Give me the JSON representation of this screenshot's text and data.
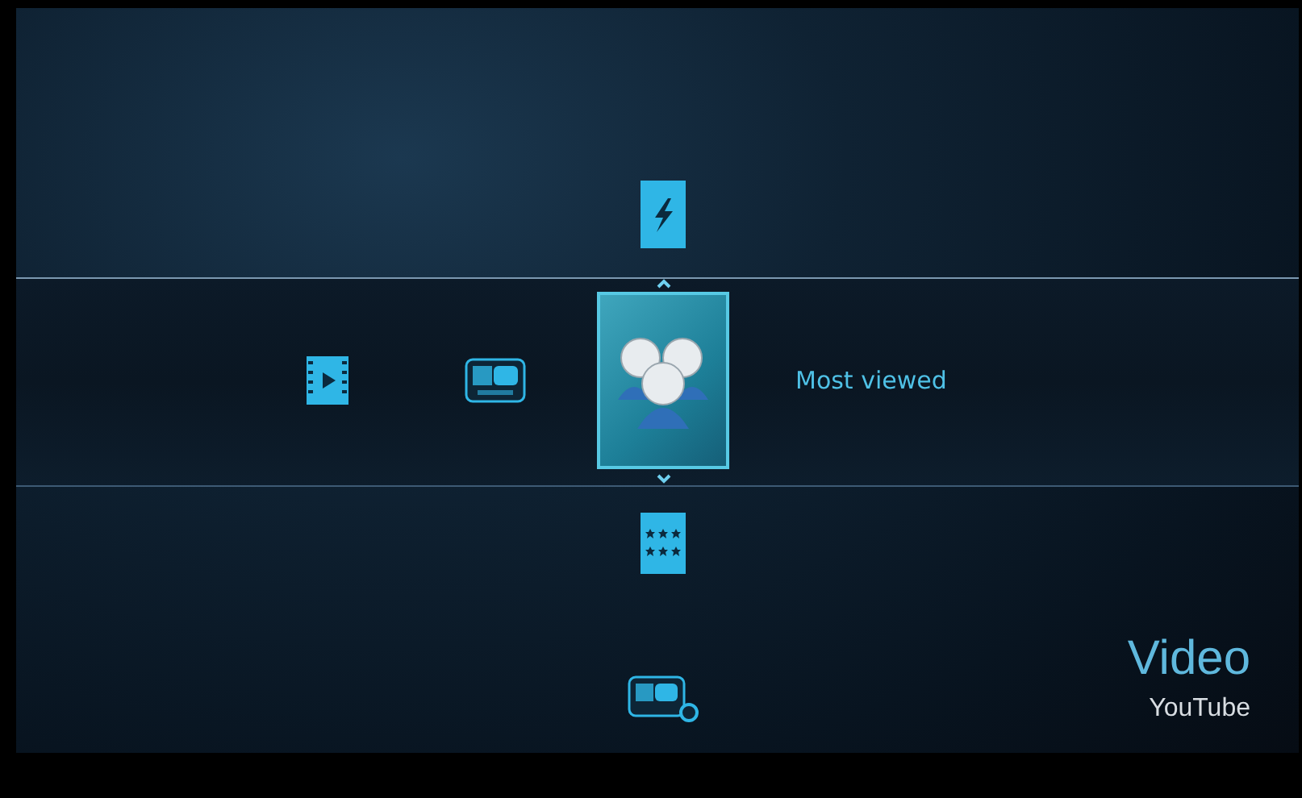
{
  "menu": {
    "row": [
      {
        "kind": "film",
        "selected": false
      },
      {
        "kind": "youtube",
        "selected": false
      },
      {
        "kind": "people",
        "selected": true
      }
    ],
    "above": {
      "kind": "bolt"
    },
    "below": {
      "kind": "stars"
    },
    "selected_label": "Most viewed",
    "bottom": {
      "kind": "youtube-add"
    }
  },
  "section": {
    "title": "Video",
    "subtitle": "YouTube"
  }
}
